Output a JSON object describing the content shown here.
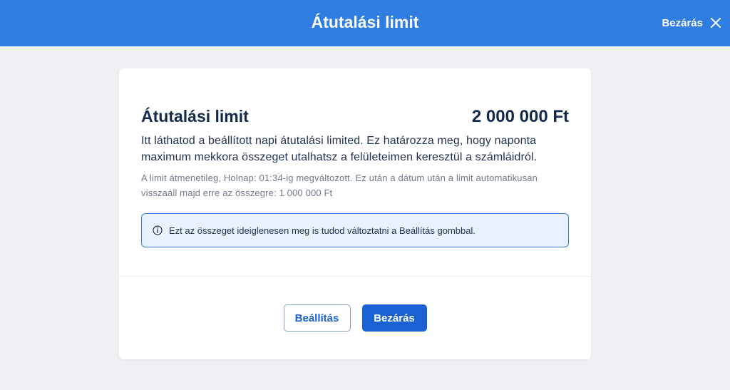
{
  "header": {
    "title": "Átutalási limit",
    "close_label": "Bezárás",
    "close_icon": "close-icon"
  },
  "card": {
    "title": "Átutalási limit",
    "amount": "2 000 000 Ft",
    "description": "Itt láthatod a beállított napi átutalási limited. Ez határozza meg, hogy naponta maximum mekkora összeget utalhatsz a felületeimen keresztül a számláidról.",
    "note": "A limit átmenetileg, Holnap: 01:34-ig megváltozott. Ez után a dátum után a limit automatikusan visszaáll majd erre az összegre: 1 000 000 Ft",
    "info": {
      "icon": "info-icon",
      "text": "Ezt az összeget ideiglenesen meg is tudod változtatni a Beállítás gombbal."
    },
    "buttons": {
      "settings_label": "Beállítás",
      "close_label": "Bezárás"
    }
  },
  "colors": {
    "header_bg": "#2f7de1",
    "primary": "#1a62d4",
    "heading_text": "#13294b",
    "page_bg": "#eef0f3",
    "info_bg": "#e9f1fd"
  }
}
